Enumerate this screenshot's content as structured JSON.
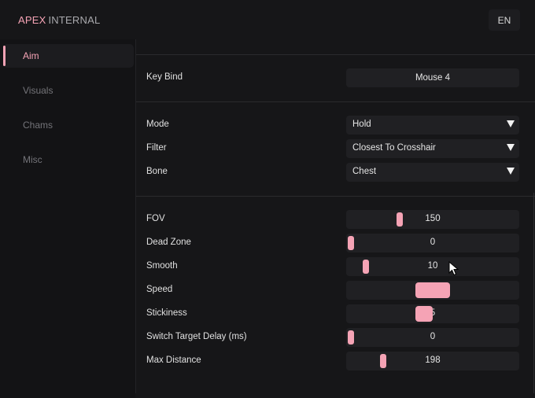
{
  "header": {
    "brand_accent": "APEX",
    "brand_rest": "INTERNAL",
    "language": "EN"
  },
  "sidebar": {
    "items": [
      {
        "label": "Aim",
        "active": true
      },
      {
        "label": "Visuals",
        "active": false
      },
      {
        "label": "Chams",
        "active": false
      },
      {
        "label": "Misc",
        "active": false
      }
    ]
  },
  "aim": {
    "keybind": {
      "label": "Key Bind",
      "value": "Mouse 4"
    },
    "mode": {
      "label": "Mode",
      "value": "Hold"
    },
    "filter": {
      "label": "Filter",
      "value": "Closest To Crosshair"
    },
    "bone": {
      "label": "Bone",
      "value": "Chest"
    },
    "sliders": {
      "fov": {
        "label": "FOV",
        "value": "150"
      },
      "dead_zone": {
        "label": "Dead Zone",
        "value": "0"
      },
      "smooth": {
        "label": "Smooth",
        "value": "10"
      },
      "speed": {
        "label": "Speed",
        "value": "3"
      },
      "stickiness": {
        "label": "Stickiness",
        "value": "5"
      },
      "switch_delay": {
        "label": "Switch Target Delay (ms)",
        "value": "0"
      },
      "max_distance": {
        "label": "Max Distance",
        "value": "198"
      }
    }
  },
  "colors": {
    "accent": "#f5a3b5",
    "background": "#161618",
    "control": "#202023"
  }
}
